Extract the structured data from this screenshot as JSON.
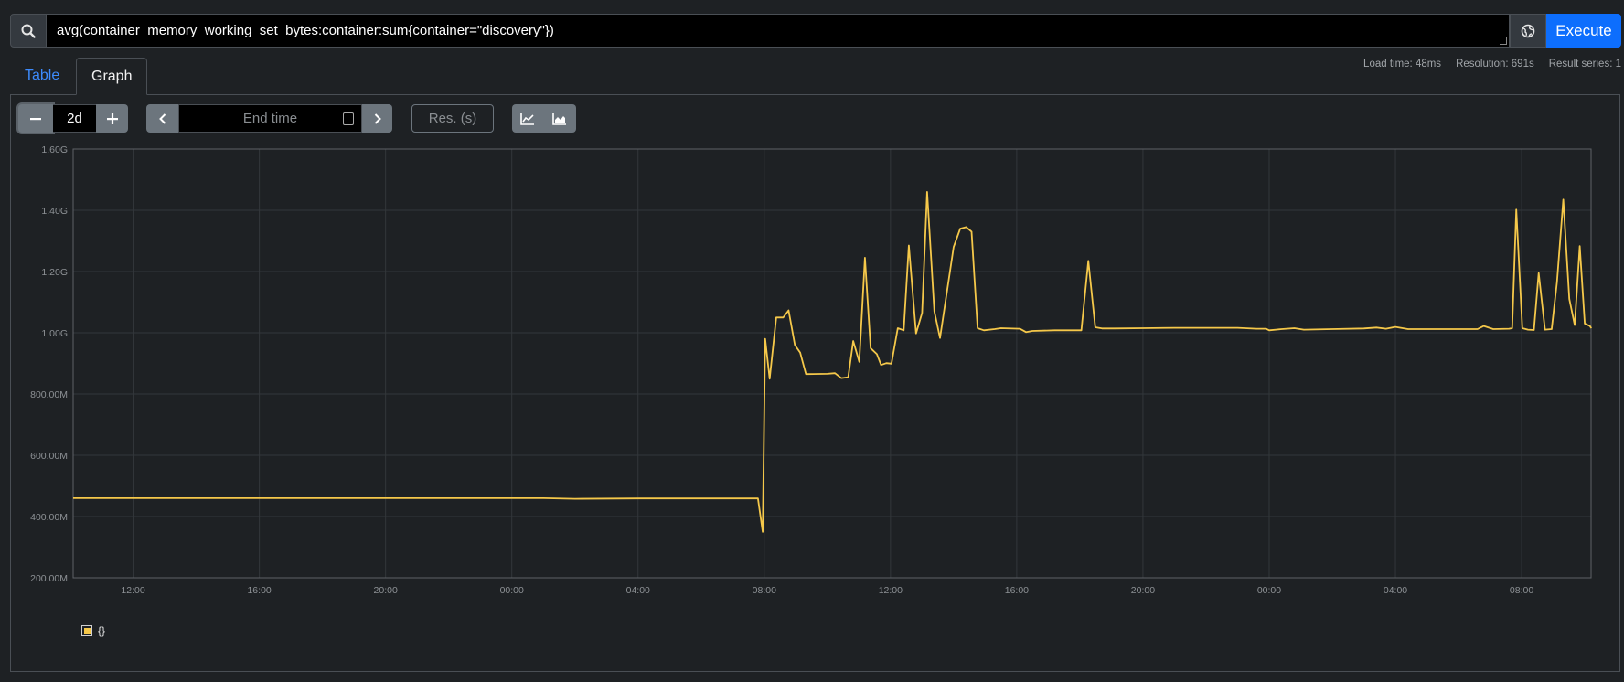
{
  "query": {
    "expression": "avg(container_memory_working_set_bytes:container:sum{container=\"discovery\"})",
    "execute_label": "Execute"
  },
  "tabs": {
    "table": "Table",
    "graph": "Graph"
  },
  "stats": {
    "load_time": "Load time: 48ms",
    "resolution": "Resolution: 691s",
    "result_series": "Result series: 1"
  },
  "controls": {
    "range": "2d",
    "end_time_placeholder": "End time",
    "resolution_placeholder": "Res. (s)"
  },
  "colors": {
    "series": "#f5c84a",
    "accent": "#0d6efd",
    "grid": "#33373b"
  },
  "legend": {
    "label": "{}"
  },
  "chart_data": {
    "type": "line",
    "title": "",
    "xlabel": "",
    "ylabel": "",
    "ylim": [
      200000000,
      1600000000
    ],
    "y_ticks": [
      {
        "v": 200000000,
        "label": "200.00M"
      },
      {
        "v": 400000000,
        "label": "400.00M"
      },
      {
        "v": 600000000,
        "label": "600.00M"
      },
      {
        "v": 800000000,
        "label": "800.00M"
      },
      {
        "v": 1000000000,
        "label": "1.00G"
      },
      {
        "v": 1200000000,
        "label": "1.20G"
      },
      {
        "v": 1400000000,
        "label": "1.40G"
      },
      {
        "v": 1600000000,
        "label": "1.60G"
      }
    ],
    "xlim_hours": [
      10.1,
      58.2
    ],
    "x_ticks": [
      {
        "h": 12,
        "label": "12:00"
      },
      {
        "h": 16,
        "label": "16:00"
      },
      {
        "h": 20,
        "label": "20:00"
      },
      {
        "h": 24,
        "label": "00:00"
      },
      {
        "h": 28,
        "label": "04:00"
      },
      {
        "h": 32,
        "label": "08:00"
      },
      {
        "h": 36,
        "label": "12:00"
      },
      {
        "h": 40,
        "label": "16:00"
      },
      {
        "h": 44,
        "label": "20:00"
      },
      {
        "h": 48,
        "label": "00:00"
      },
      {
        "h": 52,
        "label": "04:00"
      },
      {
        "h": 56,
        "label": "08:00"
      }
    ],
    "grid": true,
    "series": [
      {
        "name": "{}",
        "points": [
          [
            10.1,
            460
          ],
          [
            20.0,
            460
          ],
          [
            25.0,
            460
          ],
          [
            26.0,
            458
          ],
          [
            28.0,
            459
          ],
          [
            30.0,
            459
          ],
          [
            31.8,
            459
          ],
          [
            31.88,
            400
          ],
          [
            31.95,
            350
          ],
          [
            32.03,
            980
          ],
          [
            32.17,
            850
          ],
          [
            32.38,
            1050
          ],
          [
            32.6,
            1050
          ],
          [
            32.77,
            1073
          ],
          [
            32.97,
            960
          ],
          [
            33.14,
            935
          ],
          [
            33.32,
            865
          ],
          [
            34.0,
            866
          ],
          [
            34.24,
            868
          ],
          [
            34.44,
            852
          ],
          [
            34.66,
            855
          ],
          [
            34.82,
            973
          ],
          [
            35.01,
            905
          ],
          [
            35.19,
            1245
          ],
          [
            35.37,
            950
          ],
          [
            35.57,
            930
          ],
          [
            35.7,
            895
          ],
          [
            35.87,
            901
          ],
          [
            36.03,
            899
          ],
          [
            36.23,
            1015
          ],
          [
            36.42,
            1008
          ],
          [
            36.58,
            1285
          ],
          [
            36.81,
            998
          ],
          [
            37.0,
            1065
          ],
          [
            37.16,
            1460
          ],
          [
            37.39,
            1070
          ],
          [
            37.57,
            983
          ],
          [
            38.0,
            1280
          ],
          [
            38.21,
            1340
          ],
          [
            38.4,
            1345
          ],
          [
            38.57,
            1330
          ],
          [
            38.76,
            1015
          ],
          [
            38.96,
            1008
          ],
          [
            39.3,
            1012
          ],
          [
            39.5,
            1015
          ],
          [
            40.1,
            1013
          ],
          [
            40.3,
            1002
          ],
          [
            40.5,
            1006
          ],
          [
            41.2,
            1008
          ],
          [
            42.05,
            1008
          ],
          [
            42.27,
            1235
          ],
          [
            42.49,
            1018
          ],
          [
            42.7,
            1014
          ],
          [
            43.1,
            1014
          ],
          [
            44.0,
            1015
          ],
          [
            45.0,
            1016
          ],
          [
            47.0,
            1016
          ],
          [
            47.6,
            1013
          ],
          [
            47.9,
            1013
          ],
          [
            48.0,
            1008
          ],
          [
            48.4,
            1012
          ],
          [
            48.8,
            1015
          ],
          [
            49.1,
            1010
          ],
          [
            50.0,
            1012
          ],
          [
            51.0,
            1014
          ],
          [
            51.4,
            1017
          ],
          [
            51.7,
            1013
          ],
          [
            52.0,
            1019
          ],
          [
            52.4,
            1012
          ],
          [
            53.0,
            1012
          ],
          [
            54.0,
            1012
          ],
          [
            54.6,
            1012
          ],
          [
            54.8,
            1022
          ],
          [
            55.1,
            1012
          ],
          [
            55.6,
            1013
          ],
          [
            55.7,
            1015
          ],
          [
            55.83,
            1402
          ],
          [
            56.02,
            1015
          ],
          [
            56.2,
            1010
          ],
          [
            56.39,
            1009
          ],
          [
            56.54,
            1195
          ],
          [
            56.74,
            1010
          ],
          [
            56.95,
            1012
          ],
          [
            57.12,
            1165
          ],
          [
            57.32,
            1435
          ],
          [
            57.51,
            1110
          ],
          [
            57.68,
            1025
          ],
          [
            57.84,
            1283
          ],
          [
            58.0,
            1030
          ],
          [
            58.16,
            1022
          ],
          [
            58.21,
            1015
          ]
        ]
      }
    ]
  }
}
